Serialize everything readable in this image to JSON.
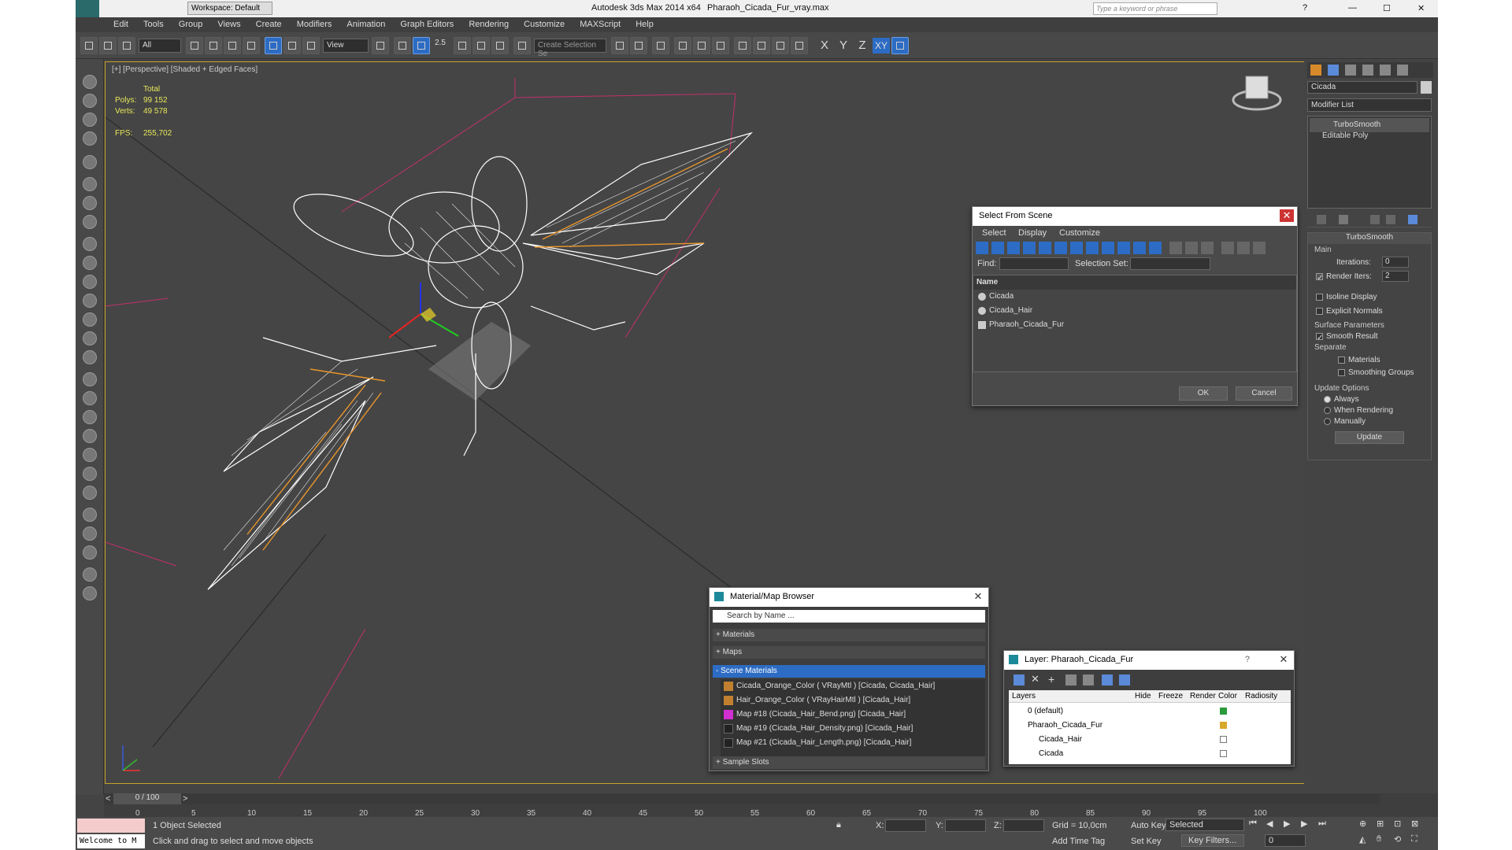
{
  "title": {
    "workspace": "Workspace: Default",
    "app": "Autodesk 3ds Max  2014 x64",
    "file": "Pharaoh_Cicada_Fur_vray.max",
    "search_placeholder": "Type a keyword or phrase"
  },
  "menu": [
    "Edit",
    "Tools",
    "Group",
    "Views",
    "Create",
    "Modifiers",
    "Animation",
    "Graph Editors",
    "Rendering",
    "Customize",
    "MAXScript",
    "Help"
  ],
  "toolbar": {
    "filter": "All",
    "ref_coord": "View",
    "snap": "2.5",
    "named_sel": "Create Selection Se",
    "axes": [
      "X",
      "Y",
      "Z",
      "XY"
    ]
  },
  "viewport": {
    "label": "[+] [Perspective] [Shaded + Edged Faces]",
    "stats_total": "Total",
    "polys_label": "Polys:",
    "polys": "99 152",
    "verts_label": "Verts:",
    "verts": "49 578",
    "fps_label": "FPS:",
    "fps": "255,702"
  },
  "command_panel": {
    "object_name": "Cicada",
    "modifier_list": "Modifier List",
    "stack": [
      "TurboSmooth",
      "Editable Poly"
    ],
    "rollout": "TurboSmooth",
    "main": "Main",
    "iterations_label": "Iterations:",
    "iterations": "0",
    "render_iters_label": "Render Iters:",
    "render_iters": "2",
    "isoline": "Isoline Display",
    "explicit": "Explicit Normals",
    "surface": "Surface Parameters",
    "smooth_result": "Smooth Result",
    "separate": "Separate",
    "materials": "Materials",
    "smoothing_groups": "Smoothing Groups",
    "update_options": "Update Options",
    "always": "Always",
    "when_rendering": "When Rendering",
    "manually": "Manually",
    "update": "Update"
  },
  "select_dialog": {
    "title": "Select From Scene",
    "menu": [
      "Select",
      "Display",
      "Customize"
    ],
    "find": "Find:",
    "selection_set": "Selection Set:",
    "column": "Name",
    "items": [
      "Cicada",
      "Cicada_Hair",
      "Pharaoh_Cicada_Fur"
    ],
    "ok": "OK",
    "cancel": "Cancel"
  },
  "material_browser": {
    "title": "Material/Map Browser",
    "search": "Search by Name ...",
    "groups": [
      "+ Materials",
      "+ Maps"
    ],
    "scene_materials": "- Scene Materials",
    "items": [
      "Cicada_Orange_Color ( VRayMtl ) [Cicada, Cicada_Hair]",
      "Hair_Orange_Color ( VRayHairMtl ) [Cicada_Hair]",
      "Map #18 (Cicada_Hair_Bend.png) [Cicada_Hair]",
      "Map #19 (Cicada_Hair_Density.png) [Cicada_Hair]",
      "Map #21 (Cicada_Hair_Length.png) [Cicada_Hair]"
    ],
    "sample_slots": "+ Sample Slots"
  },
  "layer_dialog": {
    "title": "Layer: Pharaoh_Cicada_Fur",
    "help": "?",
    "columns": [
      "Layers",
      "Hide",
      "Freeze",
      "Render",
      "Color",
      "Radiosity"
    ],
    "rows": [
      "0 (default)",
      "Pharaoh_Cicada_Fur",
      "Cicada_Hair",
      "Cicada"
    ]
  },
  "timeline": {
    "frame": "0 / 100",
    "ticks": [
      "0",
      "5",
      "10",
      "15",
      "20",
      "25",
      "30",
      "35",
      "40",
      "45",
      "50",
      "55",
      "60",
      "65",
      "70",
      "75",
      "80",
      "85",
      "90",
      "95",
      "100"
    ]
  },
  "status": {
    "maxscript": "Welcome to M",
    "selected": "1 Object Selected",
    "prompt": "Click and drag to select and move objects",
    "x": "X:",
    "y": "Y:",
    "z": "Z:",
    "grid": "Grid = 10,0cm",
    "add_time_tag": "Add Time Tag",
    "auto_key": "Auto Key",
    "set_key": "Set Key",
    "key_mode": "Selected",
    "key_filters": "Key Filters...",
    "frame_field": "0"
  }
}
